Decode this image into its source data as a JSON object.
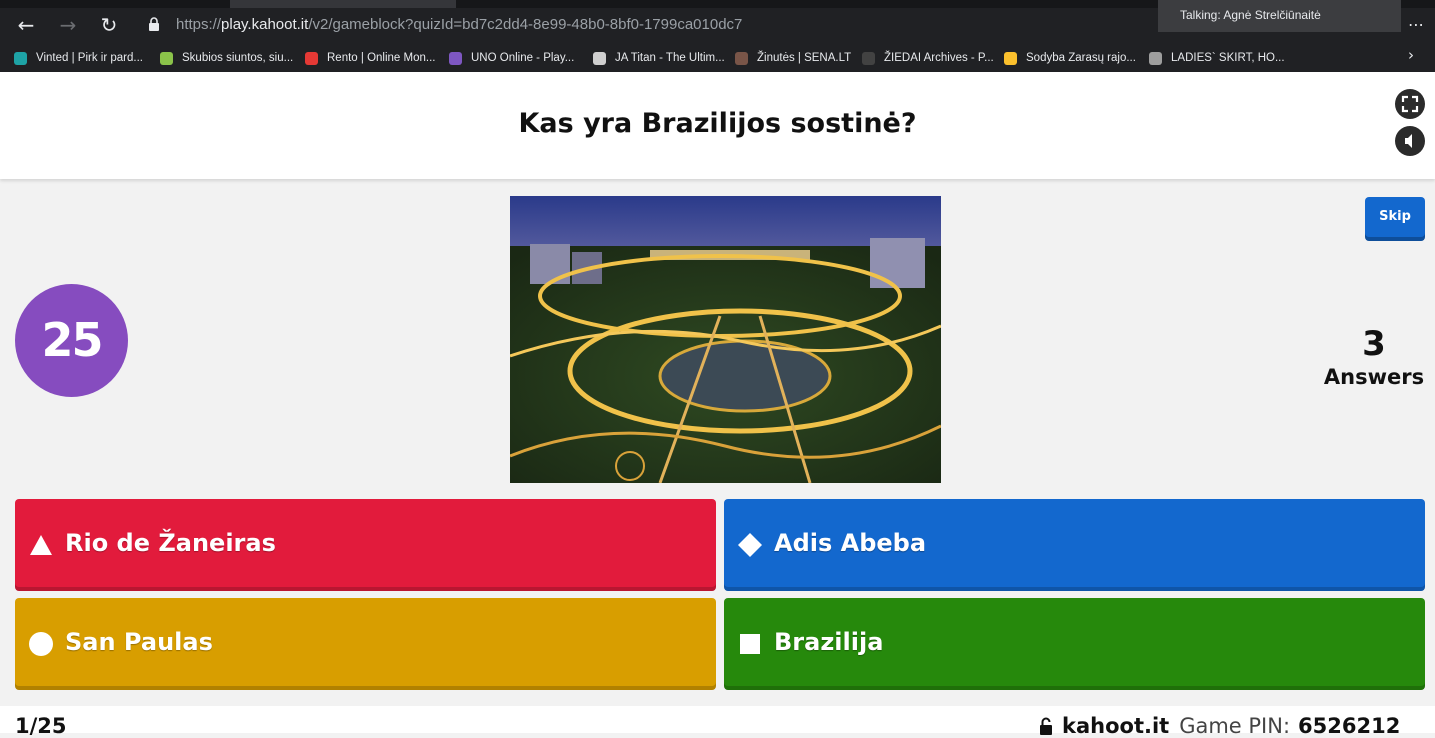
{
  "browser": {
    "url_scheme": "https://",
    "url_host": "play.kahoot.it",
    "url_path": "/v2/gameblock?quizId=bd7c2dd4-8e99-48b0-8bf0-1799ca010dc7",
    "talking_label": "Talking: Agnė Strelčiūnaitė",
    "bookmarks": [
      {
        "label": "Vinted | Pirk ir pard...",
        "color": "#1ea3a6"
      },
      {
        "label": "Skubios siuntos, siu...",
        "color": "#8bc34a"
      },
      {
        "label": "Rento | Online Mon...",
        "color": "#e53935"
      },
      {
        "label": "UNO Online - Play...",
        "color": "#7e57c2"
      },
      {
        "label": "JA Titan - The Ultim...",
        "color": "#cfcfcf"
      },
      {
        "label": "Žinutės | SENA.LT",
        "color": "#795548"
      },
      {
        "label": "ŽIEDAI Archives - P...",
        "color": "#424242"
      },
      {
        "label": "Sodyba Zarasų rajo...",
        "color": "#fbc02d"
      },
      {
        "label": "LADIES` SKIRT, HO...",
        "color": "#9e9e9e"
      }
    ]
  },
  "question": {
    "title": "Kas yra Brazilijos sostinė?",
    "timer": "25",
    "answers_count": "3",
    "answers_label": "Answers",
    "skip_label": "Skip"
  },
  "answers": [
    {
      "label": "Rio de Žaneiras",
      "shape": "triangle",
      "color": "#e21b3c"
    },
    {
      "label": "Adis Abeba",
      "shape": "diamond",
      "color": "#1368ce"
    },
    {
      "label": "San Paulas",
      "shape": "circle",
      "color": "#d89e00"
    },
    {
      "label": "Brazilija",
      "shape": "square",
      "color": "#26890c"
    }
  ],
  "footer": {
    "question_number": "1/25",
    "brand": "kahoot.it",
    "pin_label": "Game PIN:",
    "pin": "6526212"
  },
  "icons": {
    "fullscreen": "expand-icon",
    "sound": "speaker-icon",
    "lock": "lock-icon"
  }
}
